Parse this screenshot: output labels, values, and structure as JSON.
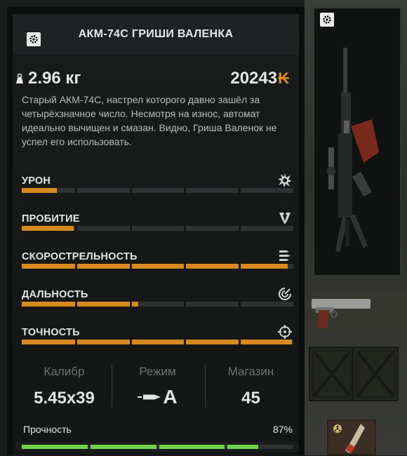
{
  "item": {
    "title": "АКМ-74С ГРИШИ ВАЛЕНКА",
    "weight": "2.96 кг",
    "price": "20243",
    "currency_symbol": "₭",
    "description": "Старый АКМ-74С, настрел которого давно зашёл за четырёхзначное число. Несмотря на износ, автомат идеально вычищен и смазан. Видно, Гриша Валенок не успел его использовать."
  },
  "stats": [
    {
      "label": "УРОН",
      "icon": "explosion-icon",
      "value": 0.13
    },
    {
      "label": "ПРОБИТИЕ",
      "icon": "penetration-icon",
      "value": 0.19
    },
    {
      "label": "СКОРОСТРЕЛЬНОСТЬ",
      "icon": "bullets-icon",
      "value": 0.98
    },
    {
      "label": "ДАЛЬНОСТЬ",
      "icon": "range-icon",
      "value": 0.43
    },
    {
      "label": "ТОЧНОСТЬ",
      "icon": "crosshair-icon",
      "value": 0.995
    }
  ],
  "info": {
    "caliber_label": "Калибр",
    "caliber_value": "5.45x39",
    "mode_label": "Режим",
    "mode_value": "A",
    "mag_label": "Магазин",
    "mag_value": "45"
  },
  "durability": {
    "label": "Прочность",
    "value": "87%",
    "fraction": 0.87
  },
  "colors": {
    "accent": "#d98a1f",
    "durability": "#6fd24a",
    "panel": "#0c0e0e"
  }
}
